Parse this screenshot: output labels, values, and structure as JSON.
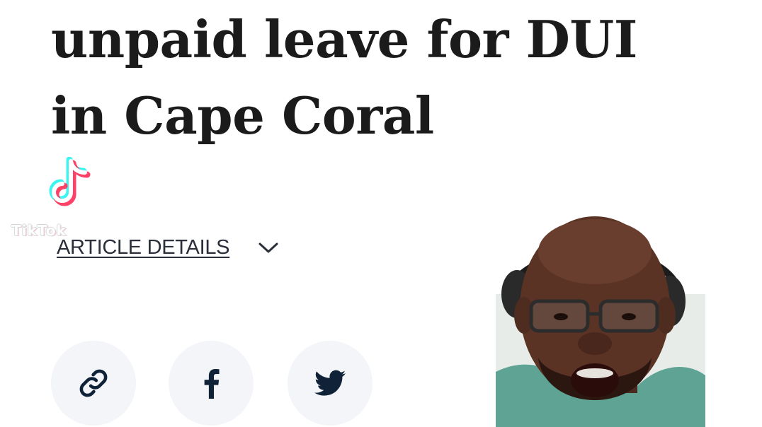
{
  "article": {
    "headline_line1": "unpaid leave for DUI",
    "headline_line2": "in Cape Coral",
    "details_label": "ARTICLE DETAILS"
  },
  "watermark": {
    "wordmark": "TikTok"
  },
  "icons": {
    "details_toggle": "chevron-down-icon",
    "share_link": "link-icon",
    "share_facebook": "facebook-icon",
    "share_twitter": "twitter-icon"
  },
  "colors": {
    "headline_text": "#1b1b1b",
    "share_button_bg": "#f3f5f8",
    "share_icon": "#0f2237",
    "tiktok_cyan": "#25f4ee",
    "tiktok_red": "#fe2c55"
  }
}
